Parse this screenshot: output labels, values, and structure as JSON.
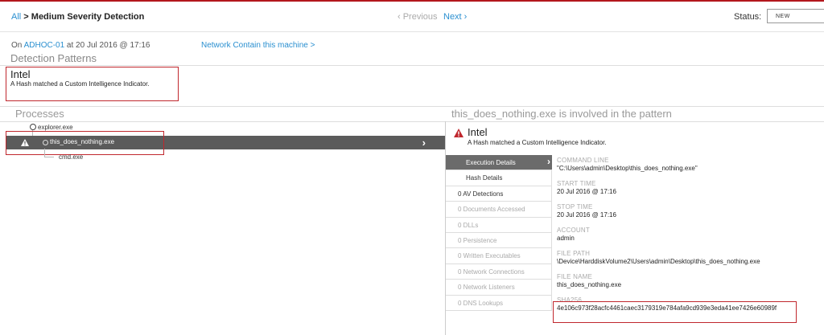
{
  "header": {
    "crumb_all": "All",
    "crumb_sep": " > ",
    "crumb_title": "Medium Severity Detection",
    "prev_label": "‹ Previous",
    "next_label": "Next ›",
    "status_label": "Status:",
    "status_value": "NEW"
  },
  "meta": {
    "on_prefix": "On ",
    "host": "ADHOC-01",
    "at_text": " at 20 Jul 2016 @ 17:16",
    "network_contain": "Network Contain this machine >"
  },
  "detection_patterns": {
    "title": "Detection Patterns",
    "intel_title": "Intel",
    "intel_desc": "A Hash matched a Custom Intelligence Indicator."
  },
  "processes": {
    "title": "Processes",
    "involved_text": "this_does_nothing.exe  is involved in the pattern",
    "parent": "explorer.exe",
    "selected": "this_does_nothing.exe",
    "child": "cmd.exe"
  },
  "right_panel": {
    "intel_title": "Intel",
    "intel_desc": "A Hash matched a Custom Intelligence Indicator.",
    "tabs": [
      {
        "label": "Execution Details",
        "active": true
      },
      {
        "label": "Hash Details",
        "active": false
      },
      {
        "label": "0 AV Detections",
        "active": false
      },
      {
        "label": "0 Documents Accessed",
        "active": false
      },
      {
        "label": "0 DLLs",
        "active": false
      },
      {
        "label": "0 Persistence",
        "active": false
      },
      {
        "label": "0 Written Executables",
        "active": false
      },
      {
        "label": "0 Network Connections",
        "active": false
      },
      {
        "label": "0 Network Listeners",
        "active": false
      },
      {
        "label": "0 DNS Lookups",
        "active": false
      }
    ],
    "fields": [
      {
        "label": "COMMAND LINE",
        "value": "\"C:\\Users\\admin\\Desktop\\this_does_nothing.exe\""
      },
      {
        "label": "START TIME",
        "value": "20 Jul 2016 @ 17:16"
      },
      {
        "label": "STOP TIME",
        "value": "20 Jul 2016 @ 17:16"
      },
      {
        "label": "ACCOUNT",
        "value": "admin"
      },
      {
        "label": "FILE PATH",
        "value": "\\Device\\HarddiskVolume2\\Users\\admin\\Desktop\\this_does_nothing.exe"
      },
      {
        "label": "FILE NAME",
        "value": "this_does_nothing.exe"
      },
      {
        "label": "SHA256",
        "value": "4e106c973f28acfc4461caec3179319e784afa9cd939e3eda41ee7426e60989f"
      }
    ]
  },
  "colors": {
    "accent_link": "#2a8fd0",
    "highlight_box": "#c0272d",
    "selected_row": "#5b5b5b"
  }
}
